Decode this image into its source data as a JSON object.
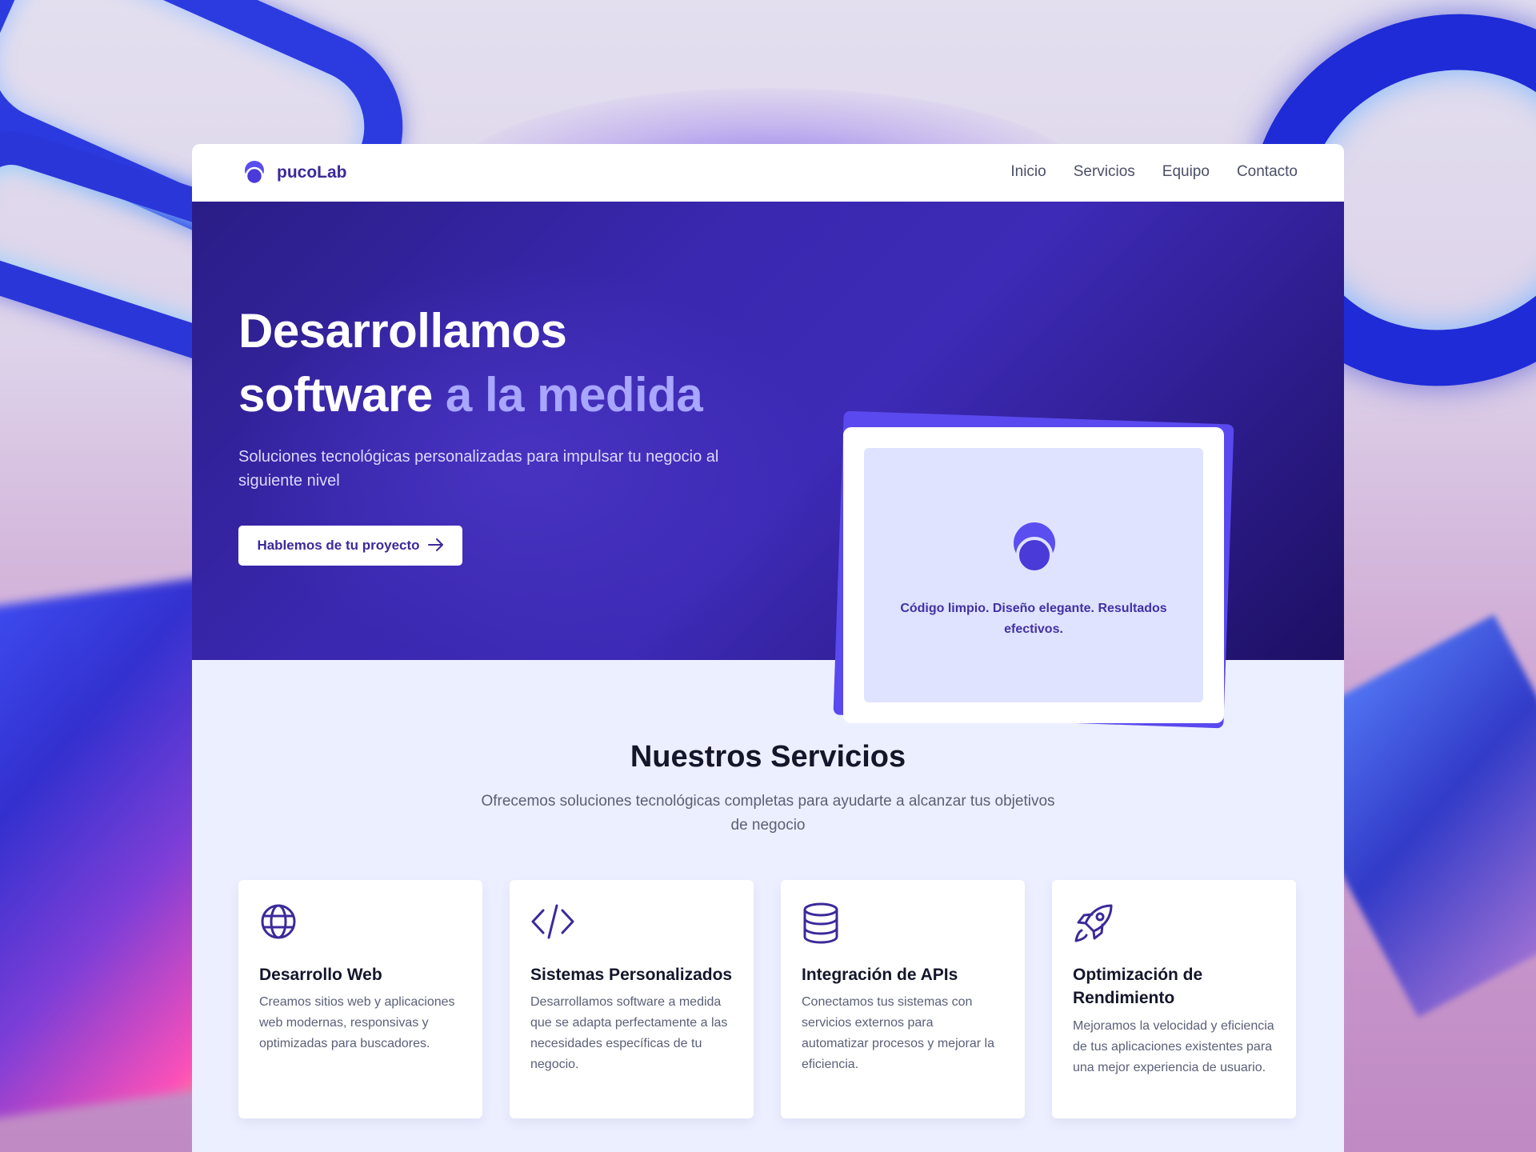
{
  "colors": {
    "brand": "#3b2a9a",
    "accent": "#a8a6ff",
    "hero_bg": "#3a28b0",
    "card_bg": "#dfe3ff"
  },
  "nav": {
    "brand_name": "pucoLab",
    "items": [
      "Inicio",
      "Servicios",
      "Equipo",
      "Contacto"
    ]
  },
  "hero": {
    "title_line1": "Desarrollamos",
    "title_line2_plain": "software",
    "title_line2_accent": "a la medida",
    "subtitle": "Soluciones tecnológicas personalizadas para impulsar tu negocio al siguiente nivel",
    "cta_label": "Hablemos de tu proyecto",
    "cta_icon": "arrow-right-icon",
    "card_text": "Código limpio. Diseño elegante. Resultados efectivos."
  },
  "services": {
    "title": "Nuestros Servicios",
    "lead": "Ofrecemos soluciones tecnológicas completas para ayudarte a alcanzar tus objetivos de negocio",
    "items": [
      {
        "icon": "globe-icon",
        "title": "Desarrollo Web",
        "text": "Creamos sitios web y aplicaciones web modernas, responsivas y optimizadas para buscadores."
      },
      {
        "icon": "code-icon",
        "title": "Sistemas Personalizados",
        "text": "Desarrollamos software a medida que se adapta perfectamente a las necesidades específicas de tu negocio."
      },
      {
        "icon": "database-icon",
        "title": "Integración de APIs",
        "text": "Conectamos tus sistemas con servicios externos para automatizar procesos y mejorar la eficiencia."
      },
      {
        "icon": "rocket-icon",
        "title": "Optimización de Rendimiento",
        "text": "Mejoramos la velocidad y eficiencia de tus aplicaciones existentes para una mejor experiencia de usuario."
      }
    ]
  }
}
